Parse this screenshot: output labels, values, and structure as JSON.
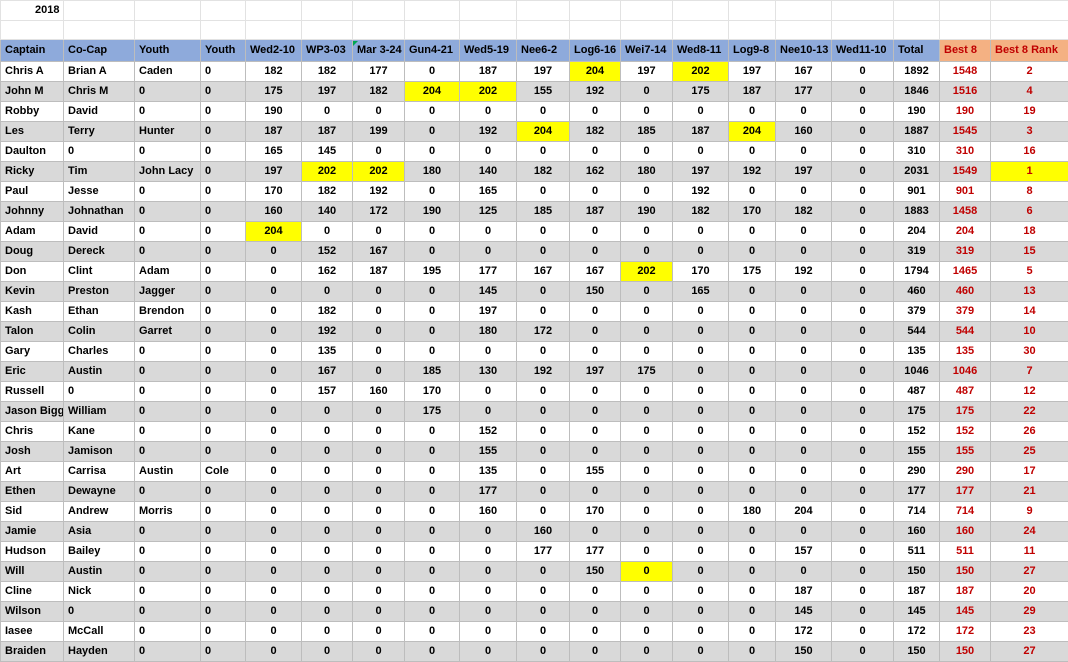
{
  "sheet": {
    "year": "2018",
    "headers": [
      "Captain",
      "Co-Cap",
      "Youth",
      "Youth",
      "Wed2-10",
      "WP3-03",
      "Mar 3-24",
      "Gun4-21",
      "Wed5-19",
      "Nee6-2",
      "Log6-16",
      "Wei7-14",
      "Wed8-11",
      "Log9-8",
      "Nee10-13",
      "Wed11-10",
      "Total",
      "Best 8",
      "Best 8 Rank"
    ],
    "highlight_color": "#ffff00",
    "header_color": "#8eaadb",
    "best_header_color": "#f4b183",
    "best_text_color": "#c00000",
    "rows": [
      {
        "cells": [
          "Chris A",
          "Brian A",
          "Caden",
          "0",
          "182",
          "182",
          "177",
          "0",
          "187",
          "197",
          "204",
          "197",
          "202",
          "197",
          "167",
          "0",
          "1892",
          "1548",
          "2"
        ],
        "hl": [
          10,
          12
        ]
      },
      {
        "cells": [
          "John M",
          "Chris M",
          "0",
          "0",
          "175",
          "197",
          "182",
          "204",
          "202",
          "155",
          "192",
          "0",
          "175",
          "187",
          "177",
          "0",
          "1846",
          "1516",
          "4"
        ],
        "hl": [
          7,
          8
        ]
      },
      {
        "cells": [
          "Robby",
          "David",
          "0",
          "0",
          "190",
          "0",
          "0",
          "0",
          "0",
          "0",
          "0",
          "0",
          "0",
          "0",
          "0",
          "0",
          "190",
          "190",
          "19"
        ],
        "hl": []
      },
      {
        "cells": [
          "Les",
          "Terry",
          "Hunter",
          "0",
          "187",
          "187",
          "199",
          "0",
          "192",
          "204",
          "182",
          "185",
          "187",
          "204",
          "160",
          "0",
          "1887",
          "1545",
          "3"
        ],
        "hl": [
          9,
          13
        ]
      },
      {
        "cells": [
          "Daulton",
          "0",
          "0",
          "0",
          "165",
          "145",
          "0",
          "0",
          "0",
          "0",
          "0",
          "0",
          "0",
          "0",
          "0",
          "0",
          "310",
          "310",
          "16"
        ],
        "hl": []
      },
      {
        "cells": [
          "Ricky",
          "Tim",
          "John Lacy",
          "0",
          "197",
          "202",
          "202",
          "180",
          "140",
          "182",
          "162",
          "180",
          "197",
          "192",
          "197",
          "0",
          "2031",
          "1549",
          "1"
        ],
        "hl": [
          5,
          6,
          18
        ]
      },
      {
        "cells": [
          "Paul",
          "Jesse",
          "0",
          "0",
          "170",
          "182",
          "192",
          "0",
          "165",
          "0",
          "0",
          "0",
          "192",
          "0",
          "0",
          "0",
          "901",
          "901",
          "8"
        ],
        "hl": []
      },
      {
        "cells": [
          "Johnny",
          "Johnathan",
          "0",
          "0",
          "160",
          "140",
          "172",
          "190",
          "125",
          "185",
          "187",
          "190",
          "182",
          "170",
          "182",
          "0",
          "1883",
          "1458",
          "6"
        ],
        "hl": []
      },
      {
        "cells": [
          "Adam",
          "David",
          "0",
          "0",
          "204",
          "0",
          "0",
          "0",
          "0",
          "0",
          "0",
          "0",
          "0",
          "0",
          "0",
          "0",
          "204",
          "204",
          "18"
        ],
        "hl": [
          4
        ]
      },
      {
        "cells": [
          "Doug",
          "Dereck",
          "0",
          "0",
          "0",
          "152",
          "167",
          "0",
          "0",
          "0",
          "0",
          "0",
          "0",
          "0",
          "0",
          "0",
          "319",
          "319",
          "15"
        ],
        "hl": []
      },
      {
        "cells": [
          "Don",
          "Clint",
          "Adam",
          "0",
          "0",
          "162",
          "187",
          "195",
          "177",
          "167",
          "167",
          "202",
          "170",
          "175",
          "192",
          "0",
          "1794",
          "1465",
          "5"
        ],
        "hl": [
          11
        ]
      },
      {
        "cells": [
          "Kevin",
          "Preston",
          "Jagger",
          "0",
          "0",
          "0",
          "0",
          "0",
          "145",
          "0",
          "150",
          "0",
          "165",
          "0",
          "0",
          "0",
          "460",
          "460",
          "13"
        ],
        "hl": []
      },
      {
        "cells": [
          "Kash",
          "Ethan",
          "Brendon",
          "0",
          "0",
          "182",
          "0",
          "0",
          "197",
          "0",
          "0",
          "0",
          "0",
          "0",
          "0",
          "0",
          "379",
          "379",
          "14"
        ],
        "hl": []
      },
      {
        "cells": [
          "Talon",
          "Colin",
          "Garret",
          "0",
          "0",
          "192",
          "0",
          "0",
          "180",
          "172",
          "0",
          "0",
          "0",
          "0",
          "0",
          "0",
          "544",
          "544",
          "10"
        ],
        "hl": []
      },
      {
        "cells": [
          "Gary",
          "Charles",
          "0",
          "0",
          "0",
          "135",
          "0",
          "0",
          "0",
          "0",
          "0",
          "0",
          "0",
          "0",
          "0",
          "0",
          "135",
          "135",
          "30"
        ],
        "hl": []
      },
      {
        "cells": [
          "Eric",
          "Austin",
          "0",
          "0",
          "0",
          "167",
          "0",
          "185",
          "130",
          "192",
          "197",
          "175",
          "0",
          "0",
          "0",
          "0",
          "1046",
          "1046",
          "7"
        ],
        "hl": []
      },
      {
        "cells": [
          "Russell",
          "0",
          "0",
          "0",
          "0",
          "157",
          "160",
          "170",
          "0",
          "0",
          "0",
          "0",
          "0",
          "0",
          "0",
          "0",
          "487",
          "487",
          "12"
        ],
        "hl": []
      },
      {
        "cells": [
          "Jason Bigg",
          "William",
          "0",
          "0",
          "0",
          "0",
          "0",
          "175",
          "0",
          "0",
          "0",
          "0",
          "0",
          "0",
          "0",
          "0",
          "175",
          "175",
          "22"
        ],
        "hl": []
      },
      {
        "cells": [
          "Chris",
          "Kane",
          "0",
          "0",
          "0",
          "0",
          "0",
          "0",
          "152",
          "0",
          "0",
          "0",
          "0",
          "0",
          "0",
          "0",
          "152",
          "152",
          "26"
        ],
        "hl": []
      },
      {
        "cells": [
          "Josh",
          "Jamison",
          "0",
          "0",
          "0",
          "0",
          "0",
          "0",
          "155",
          "0",
          "0",
          "0",
          "0",
          "0",
          "0",
          "0",
          "155",
          "155",
          "25"
        ],
        "hl": []
      },
      {
        "cells": [
          "Art",
          "Carrisa",
          "Austin",
          "Cole",
          "0",
          "0",
          "0",
          "0",
          "135",
          "0",
          "155",
          "0",
          "0",
          "0",
          "0",
          "0",
          "290",
          "290",
          "17"
        ],
        "hl": []
      },
      {
        "cells": [
          "Ethen",
          "Dewayne",
          "0",
          "0",
          "0",
          "0",
          "0",
          "0",
          "177",
          "0",
          "0",
          "0",
          "0",
          "0",
          "0",
          "0",
          "177",
          "177",
          "21"
        ],
        "hl": []
      },
      {
        "cells": [
          "Sid",
          "Andrew",
          "Morris",
          "0",
          "0",
          "0",
          "0",
          "0",
          "160",
          "0",
          "170",
          "0",
          "0",
          "180",
          "204",
          "0",
          "714",
          "714",
          "9"
        ],
        "hl": []
      },
      {
        "cells": [
          "Jamie",
          "Asia",
          "0",
          "0",
          "0",
          "0",
          "0",
          "0",
          "0",
          "160",
          "0",
          "0",
          "0",
          "0",
          "0",
          "0",
          "160",
          "160",
          "24"
        ],
        "hl": []
      },
      {
        "cells": [
          "Hudson",
          "Bailey",
          "0",
          "0",
          "0",
          "0",
          "0",
          "0",
          "0",
          "177",
          "177",
          "0",
          "0",
          "0",
          "157",
          "0",
          "511",
          "511",
          "11"
        ],
        "hl": []
      },
      {
        "cells": [
          "Will",
          "Austin",
          "0",
          "0",
          "0",
          "0",
          "0",
          "0",
          "0",
          "0",
          "150",
          "0",
          "0",
          "0",
          "0",
          "0",
          "150",
          "150",
          "27"
        ],
        "hl": [
          11
        ]
      },
      {
        "cells": [
          "Cline",
          "Nick",
          "0",
          "0",
          "0",
          "0",
          "0",
          "0",
          "0",
          "0",
          "0",
          "0",
          "0",
          "0",
          "187",
          "0",
          "187",
          "187",
          "20"
        ],
        "hl": []
      },
      {
        "cells": [
          "Wilson",
          "0",
          "0",
          "0",
          "0",
          "0",
          "0",
          "0",
          "0",
          "0",
          "0",
          "0",
          "0",
          "0",
          "145",
          "0",
          "145",
          "145",
          "29"
        ],
        "hl": []
      },
      {
        "cells": [
          "Iasee",
          "McCall",
          "0",
          "0",
          "0",
          "0",
          "0",
          "0",
          "0",
          "0",
          "0",
          "0",
          "0",
          "0",
          "172",
          "0",
          "172",
          "172",
          "23"
        ],
        "hl": []
      },
      {
        "cells": [
          "Braiden",
          "Hayden",
          "0",
          "0",
          "0",
          "0",
          "0",
          "0",
          "0",
          "0",
          "0",
          "0",
          "0",
          "0",
          "150",
          "0",
          "150",
          "150",
          "27"
        ],
        "hl": []
      }
    ]
  }
}
